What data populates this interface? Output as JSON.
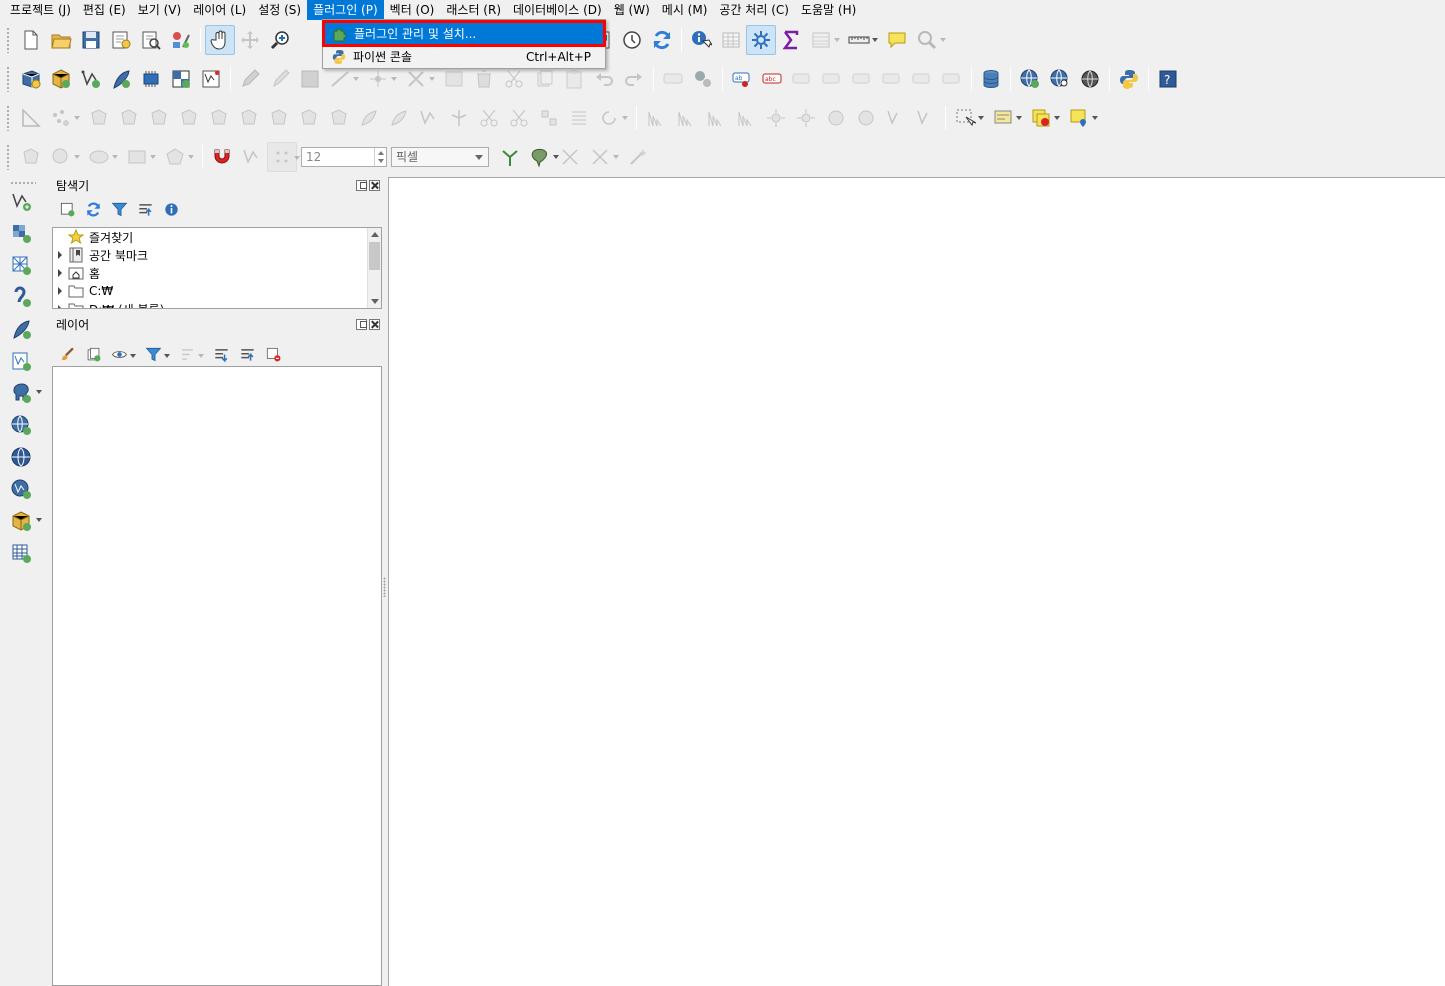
{
  "menubar": {
    "items": [
      {
        "label": "프로젝트 (J)"
      },
      {
        "label": "편집 (E)"
      },
      {
        "label": "보기 (V)"
      },
      {
        "label": "레이어 (L)"
      },
      {
        "label": "설정 (S)"
      },
      {
        "label": "플러그인 (P)"
      },
      {
        "label": "벡터 (O)"
      },
      {
        "label": "래스터 (R)"
      },
      {
        "label": "데이터베이스 (D)"
      },
      {
        "label": "웹 (W)"
      },
      {
        "label": "메시 (M)"
      },
      {
        "label": "공간 처리 (C)"
      },
      {
        "label": "도움말 (H)"
      }
    ],
    "active_index": 5
  },
  "plugin_menu": {
    "items": [
      {
        "label": "플러그인 관리 및 설치...",
        "shortcut": "",
        "icon": "puzzle-icon",
        "highlighted": true
      },
      {
        "label": "파이썬 콘솔",
        "shortcut": "Ctrl+Alt+P",
        "icon": "python-icon",
        "highlighted": false
      }
    ],
    "highlight_color": "#0078d7",
    "annotation_box_color": "#ff0000"
  },
  "snapping": {
    "tolerance_value": "12",
    "units_value": "픽셀"
  },
  "browser_panel": {
    "title": "탐색기",
    "items": [
      {
        "label": "즐겨찾기",
        "icon": "star-icon",
        "expandable": false
      },
      {
        "label": "공간 북마크",
        "icon": "bookmark-icon",
        "expandable": true
      },
      {
        "label": "홈",
        "icon": "home-folder-icon",
        "expandable": true
      },
      {
        "label": "C:₩",
        "icon": "folder-icon",
        "expandable": true
      },
      {
        "label": "D:₩ (새 볼륨)",
        "icon": "folder-icon",
        "expandable": true
      }
    ]
  },
  "layers_panel": {
    "title": "레이어"
  },
  "colors": {
    "accent": "#0078d7",
    "annotation": "#ff0000"
  }
}
